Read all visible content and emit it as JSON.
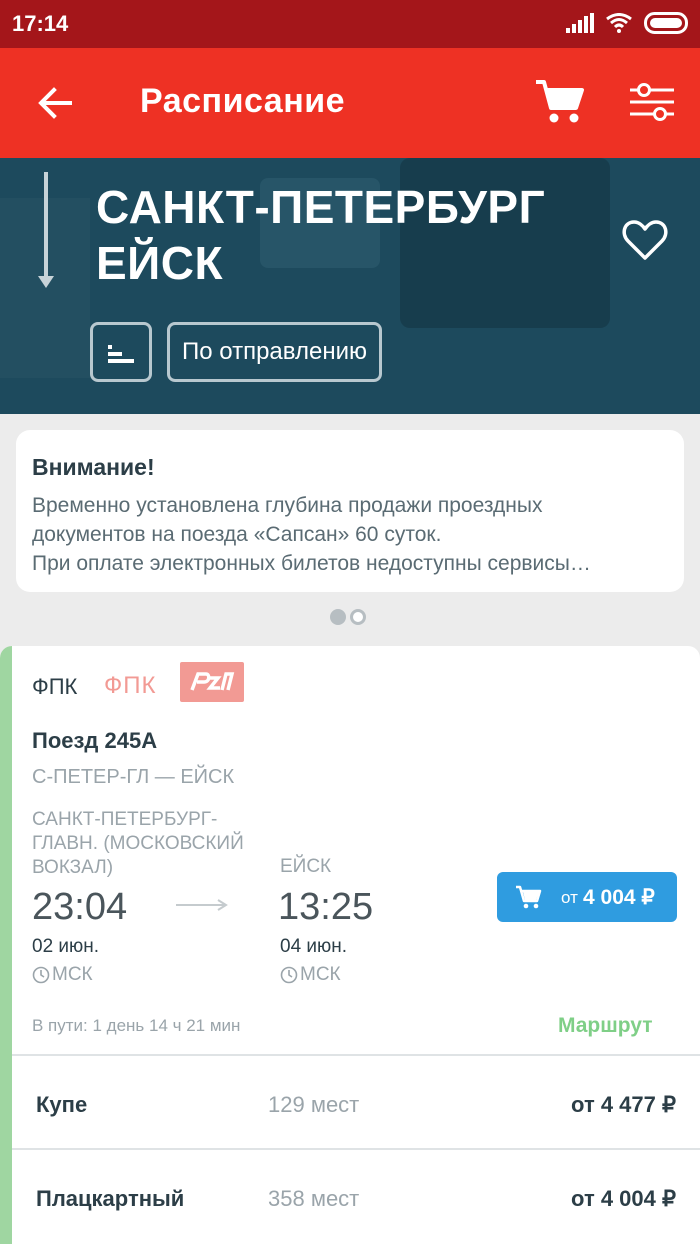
{
  "status_bar": {
    "time": "17:14"
  },
  "app_bar": {
    "title": "Расписание"
  },
  "route": {
    "from": "САНКТ-ПЕТЕРБУРГ",
    "to": "ЕЙСК",
    "sort_label": "По отправлению"
  },
  "notice": {
    "title": "Внимание!",
    "lines": [
      "Временно установлена глубина продажи проездных",
      "документов на поезда «Сапсан» 60 суток.",
      "При оплате электронных билетов недоступны сервисы…"
    ]
  },
  "train_card": {
    "carrier_text": "ФПК",
    "carrier_logo_text": "ФПК",
    "train_name": "Поезд 245А",
    "route_short": "С-ПЕТЕР-ГЛ — ЕЙСК",
    "departure": {
      "station_lines": [
        "САНКТ-ПЕТЕРБУРГ-",
        "ГЛАВН. (МОСКОВСКИЙ",
        "ВОКЗАЛ)"
      ],
      "time": "23:04",
      "date": "02 июн.",
      "timezone": "МСК"
    },
    "arrival": {
      "station": "ЕЙСК",
      "time": "13:25",
      "date": "04 июн.",
      "timezone": "МСК"
    },
    "price_button": {
      "prefix": "от",
      "value": "4 004 ₽"
    },
    "duration": "В пути: 1 день 14 ч 21 мин",
    "route_link": "Маршрут",
    "classes": [
      {
        "name": "Купе",
        "seats": "129 мест",
        "price": "от 4 477 ₽"
      },
      {
        "name": "Плацкартный",
        "seats": "358 мест",
        "price": "от 4 004 ₽"
      }
    ]
  }
}
